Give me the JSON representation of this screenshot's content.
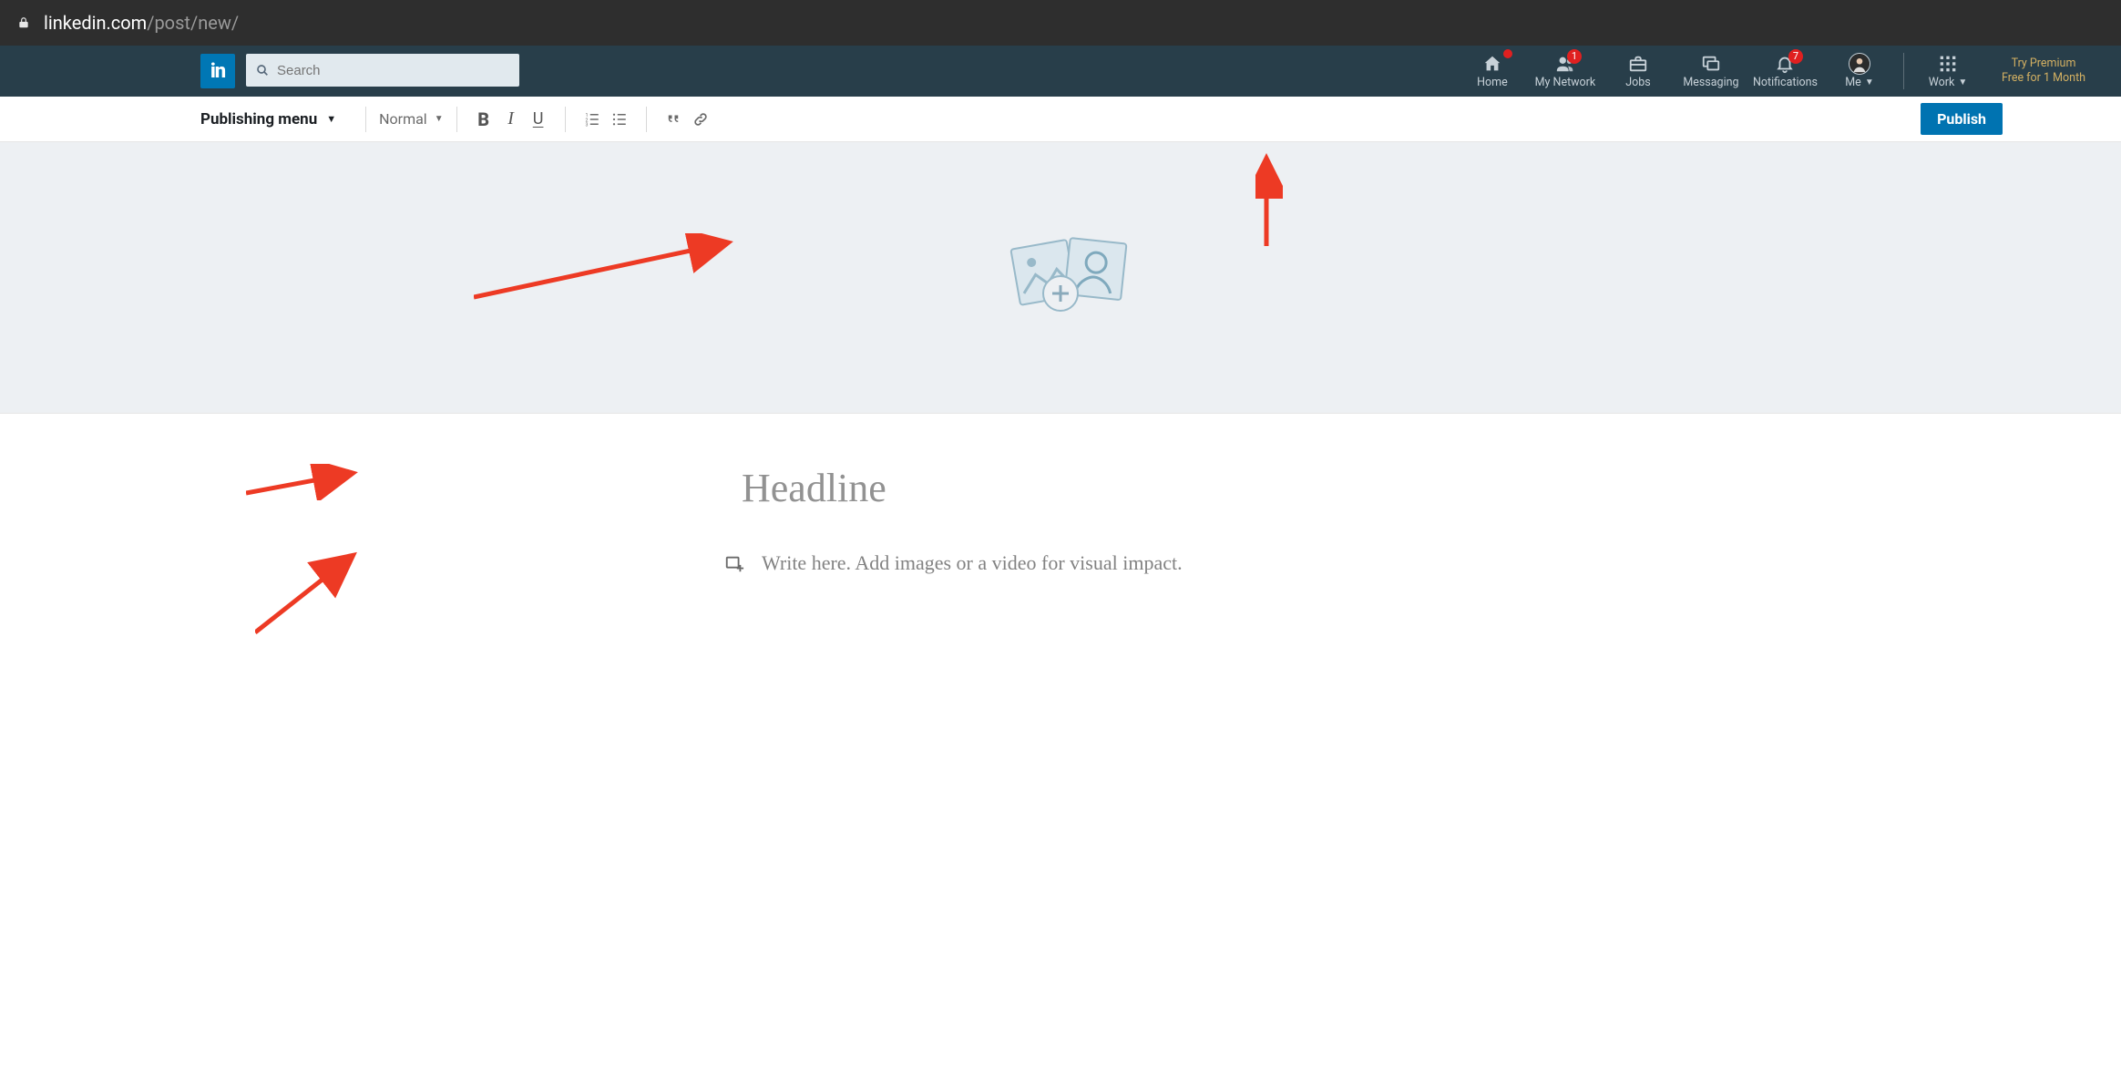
{
  "browser": {
    "url_host": "linkedin.com",
    "url_path": "/post/new/"
  },
  "nav": {
    "search_placeholder": "Search",
    "items": [
      {
        "key": "home",
        "label": "Home",
        "badge": ""
      },
      {
        "key": "network",
        "label": "My Network",
        "badge": "1"
      },
      {
        "key": "jobs",
        "label": "Jobs",
        "badge": ""
      },
      {
        "key": "messaging",
        "label": "Messaging",
        "badge": ""
      },
      {
        "key": "notifications",
        "label": "Notifications",
        "badge": "7"
      },
      {
        "key": "me",
        "label": "Me",
        "badge": ""
      },
      {
        "key": "work",
        "label": "Work",
        "badge": ""
      }
    ],
    "home_badge": "",
    "network_badge": "1",
    "notifications_badge": "7",
    "premium_line1": "Try Premium",
    "premium_line2": "Free for 1 Month"
  },
  "editor": {
    "publishing_menu_label": "Publishing menu",
    "text_style": "Normal",
    "publish_label": "Publish",
    "headline_placeholder": "Headline",
    "body_placeholder": "Write here. Add images or a video for visual impact."
  }
}
